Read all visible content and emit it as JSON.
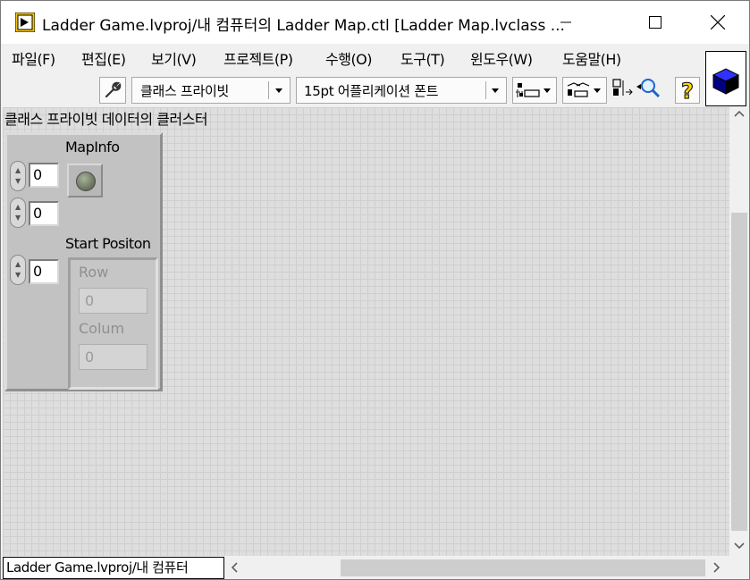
{
  "window": {
    "title": "Ladder Game.lvproj/내 컴퓨터의 Ladder Map.ctl [Ladder Map.lvclass ..."
  },
  "menu": {
    "items": [
      "파일(F)",
      "편집(E)",
      "보기(V)",
      "프로젝트(P)",
      "수행(O)",
      "도구(T)",
      "윈도우(W)",
      "도움말(H)"
    ]
  },
  "toolbar": {
    "access_scope": "클래스 프라이빗",
    "font": "15pt 어플리케이션 폰트"
  },
  "canvas": {
    "label": "클래스 프라이빗 데이터의 클러스터"
  },
  "cluster": {
    "mapinfo_label": "MapInfo",
    "num1": "0",
    "num2": "0",
    "start_label": "Start Positon",
    "num3": "0",
    "row_label": "Row",
    "row_value": "0",
    "col_label": "Colum",
    "col_value": "0"
  },
  "status": {
    "context": "Ladder Game.lvproj/내 컴퓨터"
  },
  "icons": {
    "app": "labview-vi-icon",
    "wrench": "wrench-icon",
    "help": "context-help-icon"
  },
  "colors": {
    "canvas": "#dedede",
    "cluster": "#c2c2c2",
    "help_yellow": "#ffd800",
    "cube_blue": "#0000b8"
  }
}
